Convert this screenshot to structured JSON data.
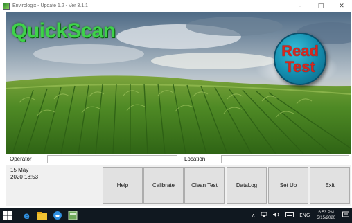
{
  "window": {
    "title": "Envirologix - Update 1.2 - Ver 3.1.1",
    "controls": [
      "–",
      "□",
      "✕"
    ]
  },
  "hero": {
    "brand": "QuickScan",
    "read_test": {
      "line1": "Read",
      "line2": "Test"
    }
  },
  "form": {
    "operator_label": "Operator",
    "operator_value": "",
    "location_label": "Location",
    "location_value": ""
  },
  "status": {
    "date": "15 May",
    "datetime": "2020 18:53"
  },
  "buttons": {
    "help": "Help",
    "calibrate": "Calibrate",
    "clean_test": "Clean Test",
    "datalog": "DataLog",
    "setup": "Set Up",
    "exit": "Exit"
  },
  "taskbar": {
    "tray_chevron": "∧",
    "tray_lang": "ENG",
    "clock_time": "6:53 PM",
    "clock_date": "5/15/2020"
  },
  "colors": {
    "brand_green": "#3fd24a",
    "read_button": "#1590b1",
    "read_text": "#d9261c",
    "taskbar": "#101820"
  }
}
